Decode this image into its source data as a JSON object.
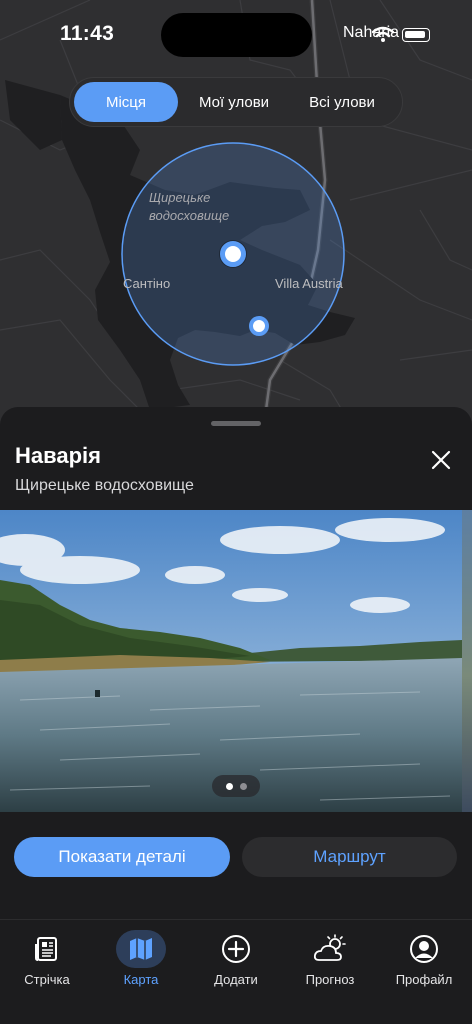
{
  "status_bar": {
    "time": "11:43",
    "carrier": "Naharia"
  },
  "segments": [
    {
      "label": "Місця",
      "active": true
    },
    {
      "label": "Мої улови",
      "active": false
    },
    {
      "label": "Всі улови",
      "active": false
    }
  ],
  "map": {
    "labels": {
      "lake": "Щирецьке водосховище",
      "village_left": "Сантіно",
      "village_right": "Villa Austria"
    }
  },
  "place": {
    "title": "Наварія",
    "subtitle": "Щирецьке водосховище"
  },
  "gallery": {
    "current_page": 1,
    "total_pages": 2
  },
  "actions": {
    "details": "Показати деталі",
    "route": "Маршрут"
  },
  "tabs": [
    {
      "label": "Стрічка",
      "icon": "newspaper-icon",
      "active": false
    },
    {
      "label": "Карта",
      "icon": "map-icon",
      "active": true
    },
    {
      "label": "Додати",
      "icon": "plus-circle-icon",
      "active": false
    },
    {
      "label": "Прогноз",
      "icon": "weather-icon",
      "active": false
    },
    {
      "label": "Профайл",
      "icon": "profile-icon",
      "active": false
    }
  ],
  "colors": {
    "accent": "#5b9cf5",
    "map_water": "#1f1f21",
    "map_land": "#2f2f31",
    "background": "#1c1c1e"
  }
}
